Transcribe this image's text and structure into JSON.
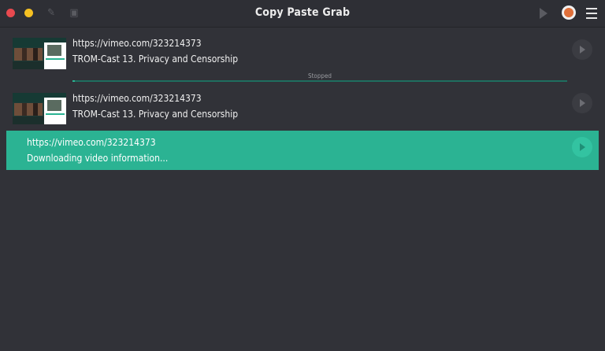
{
  "app": {
    "title": "Copy Paste Grab"
  },
  "toolbar": {
    "icons": [
      "close-button",
      "minimize-button",
      "paste-icon",
      "clipboard-icon",
      "play-icon",
      "avatar-icon",
      "menu-icon"
    ]
  },
  "downloads": [
    {
      "url": "https://vimeo.com/323214373",
      "title": "TROM-Cast 13. Privacy and Censorship",
      "status": "Stopped",
      "progress": 0.004
    },
    {
      "url": "https://vimeo.com/323214373",
      "title": "TROM-Cast 13. Privacy and Censorship"
    },
    {
      "url": "https://vimeo.com/323214373",
      "title": "Downloading video information..."
    }
  ],
  "colors": {
    "accent": "#2bb393",
    "background": "#313238",
    "titlebar": "#2e2f35",
    "close": "#e8494f",
    "minimize": "#f5c022"
  }
}
